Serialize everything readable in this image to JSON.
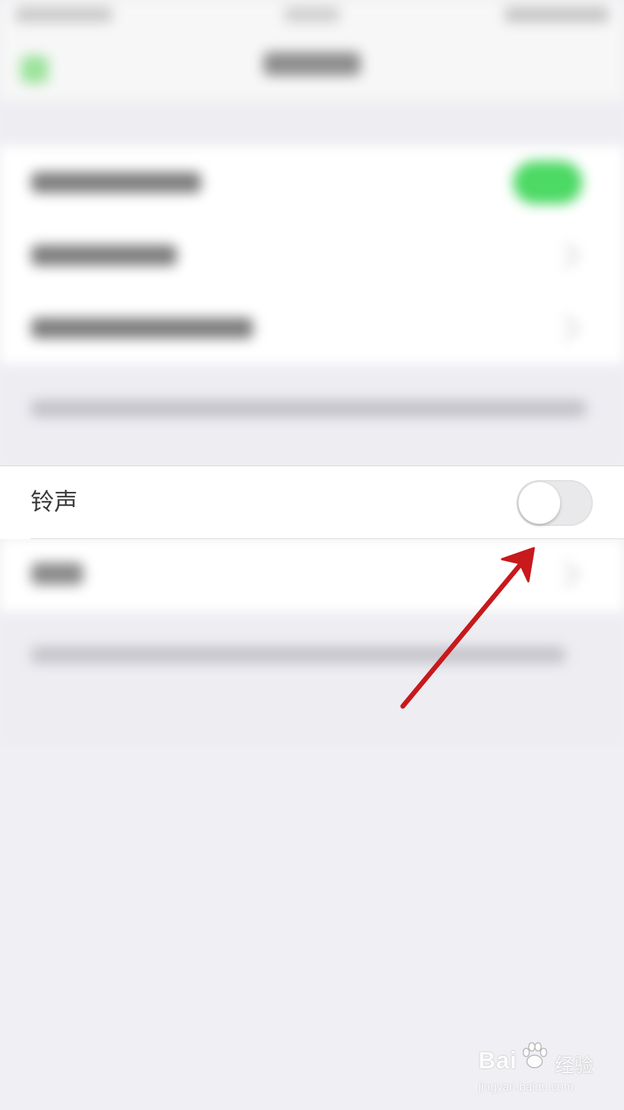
{
  "settings": {
    "ringtone": {
      "label": "铃声",
      "toggle_on": false
    }
  },
  "annotation": {
    "arrow_color": "#c8191c"
  },
  "watermark": {
    "brand": "Bai",
    "brand_suffix": "经验",
    "url": "jingyan.baidu.com"
  },
  "colors": {
    "background": "#efeff4",
    "toggle_on": "#4cd964",
    "toggle_off": "#e9e9eb"
  }
}
